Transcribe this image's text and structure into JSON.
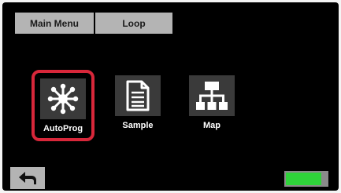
{
  "tabs": {
    "main_menu": "Main Menu",
    "loop": "Loop"
  },
  "tiles": [
    {
      "label": "AutoProg",
      "icon": "asterisk-network-icon",
      "selected": true
    },
    {
      "label": "Sample",
      "icon": "document-icon",
      "selected": false
    },
    {
      "label": "Map",
      "icon": "hierarchy-icon",
      "selected": false
    }
  ],
  "status": {
    "battery_level": 0.86
  },
  "colors": {
    "selection": "#d8273a",
    "battery": "#2fd23a",
    "tab_bg": "#b4b4b4"
  }
}
